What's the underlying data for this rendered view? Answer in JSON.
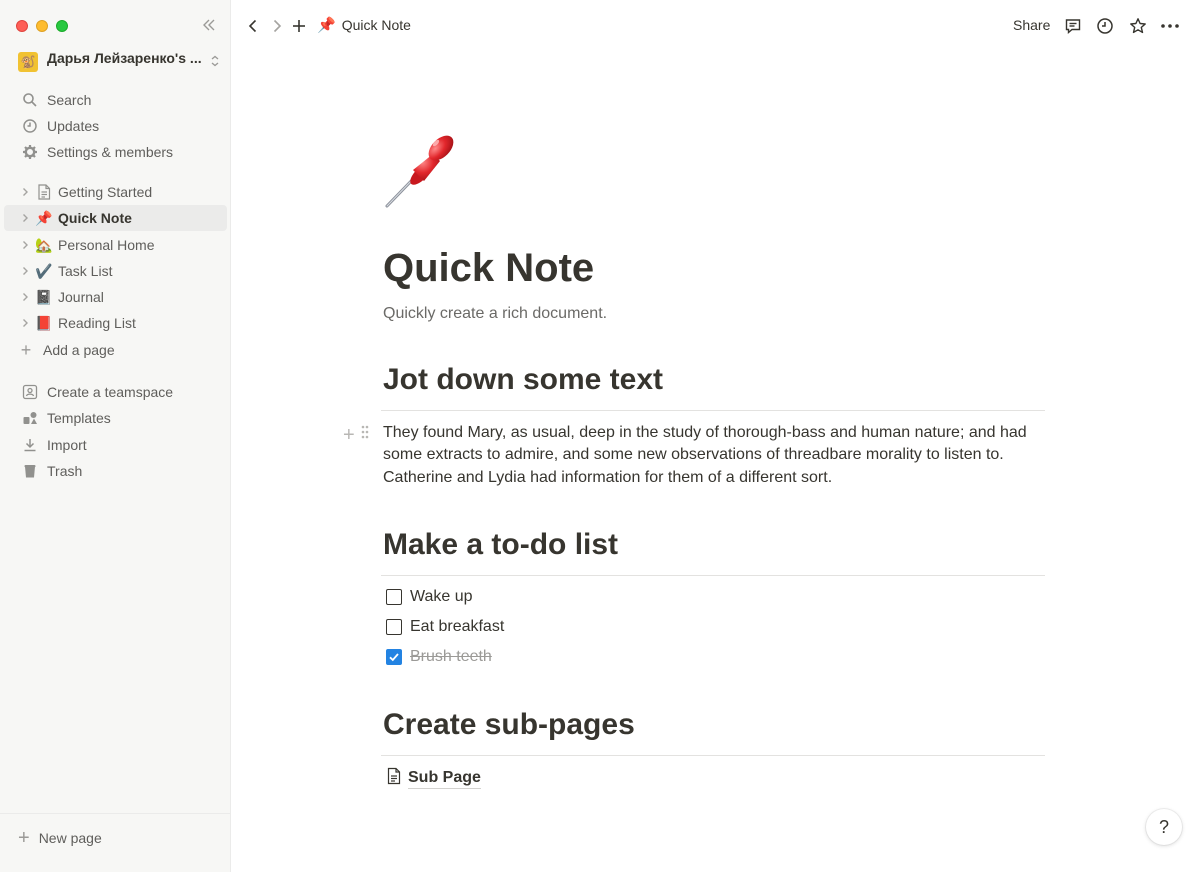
{
  "sidebar": {
    "workspace_name": "Дарья Лейзаренко's ...",
    "workspace_avatar": "🐒",
    "utility": [
      {
        "label": "Search",
        "icon": "search-icon"
      },
      {
        "label": "Updates",
        "icon": "clock-icon"
      },
      {
        "label": "Settings & members",
        "icon": "gear-icon"
      }
    ],
    "pages": [
      {
        "label": "Getting Started",
        "icon": "page-icon",
        "emoji": ""
      },
      {
        "label": "Quick Note",
        "icon": "pushpin-icon",
        "emoji": "📌",
        "active": true
      },
      {
        "label": "Personal Home",
        "icon": "house-icon",
        "emoji": "🏡"
      },
      {
        "label": "Task List",
        "icon": "checkmark-icon",
        "emoji": "✔️"
      },
      {
        "label": "Journal",
        "icon": "notebook-icon",
        "emoji": "📓"
      },
      {
        "label": "Reading List",
        "icon": "book-icon",
        "emoji": "📕"
      }
    ],
    "add_page_label": "Add a page",
    "secondary": [
      {
        "label": "Create a teamspace",
        "icon": "teamspace-icon"
      },
      {
        "label": "Templates",
        "icon": "templates-icon"
      },
      {
        "label": "Import",
        "icon": "import-icon"
      },
      {
        "label": "Trash",
        "icon": "trash-icon"
      }
    ],
    "new_page_label": "New page"
  },
  "topbar": {
    "breadcrumb_emoji": "📌",
    "breadcrumb_label": "Quick Note",
    "share_label": "Share"
  },
  "page": {
    "icon_emoji": "📌",
    "title": "Quick Note",
    "subtitle": "Quickly create a rich document.",
    "section1_heading": "Jot down some text",
    "paragraph": "They found Mary, as usual, deep in the study of thorough-bass and human nature; and had some extracts to admire, and some new observations of threadbare morality to listen to. Catherine and Lydia had information for them of a different sort.",
    "section2_heading": "Make a to-do list",
    "todos": [
      {
        "label": "Wake up",
        "checked": false
      },
      {
        "label": "Eat breakfast",
        "checked": false
      },
      {
        "label": "Brush teeth",
        "checked": true
      }
    ],
    "section3_heading": "Create sub-pages",
    "subpage_label": "Sub Page"
  },
  "help_label": "?",
  "colors": {
    "accent": "#2383e2",
    "sidebar_bg": "#f7f7f5",
    "text": "#37352f"
  }
}
